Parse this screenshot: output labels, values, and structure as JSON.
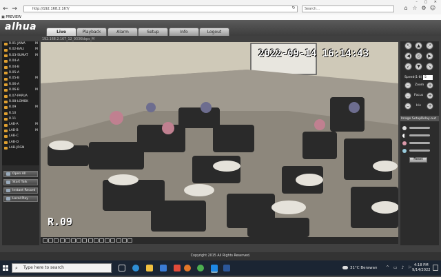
{
  "browser": {
    "url": "http://192.168.2.167/",
    "search_placeholder": "Search...",
    "tab_title": "PREVIEW"
  },
  "brand": {
    "logo": "alhua",
    "accent": "#e0a030"
  },
  "nav": {
    "tabs": [
      "Live",
      "Playback",
      "Alarm",
      "Setup",
      "Info",
      "Logout"
    ],
    "active": "Live"
  },
  "channels": [
    {
      "name": "R.01-JAWA",
      "mark": "M"
    },
    {
      "name": "R.02-BALI",
      "mark": "M"
    },
    {
      "name": "R.03-SUMAT",
      "mark": "M"
    },
    {
      "name": "R.04-A",
      "mark": ""
    },
    {
      "name": "R.04-B",
      "mark": ""
    },
    {
      "name": "R.05-A",
      "mark": ""
    },
    {
      "name": "R.05-B",
      "mark": "M"
    },
    {
      "name": "R.06-A",
      "mark": ""
    },
    {
      "name": "R.06-B",
      "mark": "M"
    },
    {
      "name": "R.07-PAPUA",
      "mark": ""
    },
    {
      "name": "R.08-LOMBK",
      "mark": ""
    },
    {
      "name": "R.09",
      "mark": "M"
    },
    {
      "name": "R.10",
      "mark": ""
    },
    {
      "name": "R.11",
      "mark": ""
    },
    {
      "name": "LAB-A",
      "mark": "M"
    },
    {
      "name": "LAB-B",
      "mark": "M"
    },
    {
      "name": "LAB-C",
      "mark": ""
    },
    {
      "name": "LAB-D",
      "mark": ""
    },
    {
      "name": "LAB-JRGN",
      "mark": ""
    }
  ],
  "sidebar_buttons": {
    "open_all": "Open All",
    "start_talk": "Start Talk",
    "instant_record": "Instant Record",
    "local_play": "Local Play"
  },
  "video": {
    "title": "192.168.2.167_12_9336kbps_M",
    "timestamp": "2022-09-14 16:14:43",
    "label": "R.09"
  },
  "ptz": {
    "speed_label": "Speed(1-8)",
    "speed_value": "5",
    "zoom": "Zoom",
    "focus": "Focus",
    "iris": "Iris"
  },
  "image_setup": {
    "label": "Image Setup",
    "relay": "Relay-out",
    "reset": "Reset"
  },
  "footer": "Copyright 2015 All Rights Reserved.",
  "taskbar": {
    "search": "Type here to search",
    "weather": "31°C  Berawan",
    "time": "4:18 PM",
    "date": "9/14/2022"
  }
}
